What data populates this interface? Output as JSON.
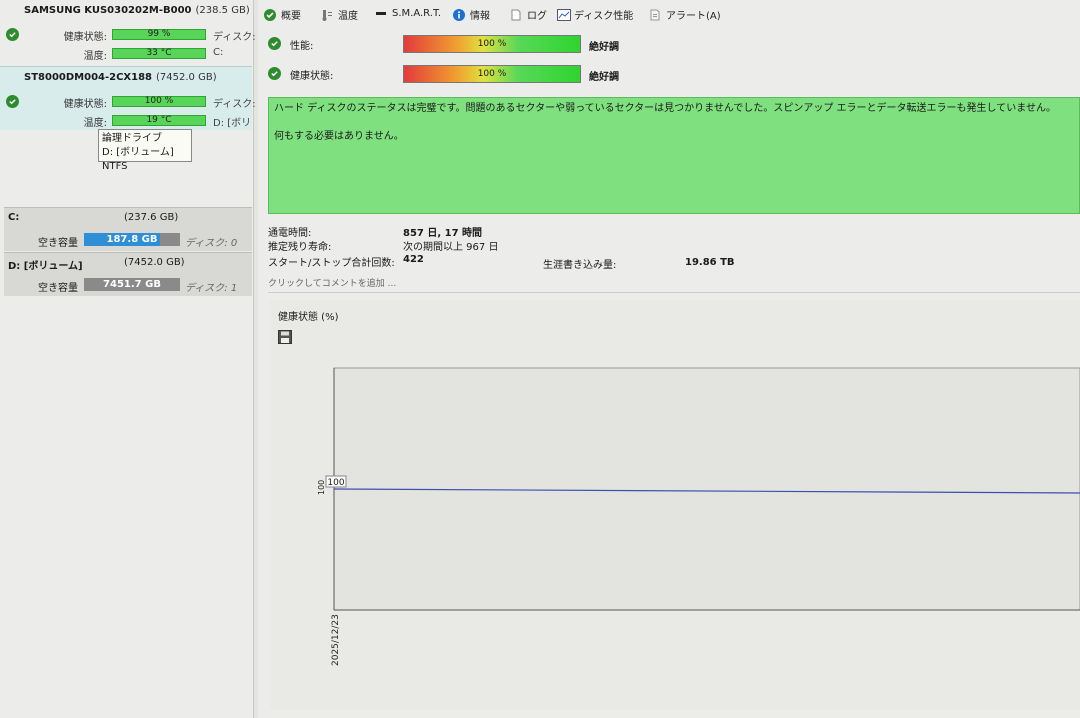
{
  "disks": [
    {
      "model": "SAMSUNG KUS030202M-B000",
      "size": "(238.5 GB)",
      "health_label": "健康状態:",
      "health_value": "99 %",
      "health_fraction": 0.99,
      "temp_label": "温度:",
      "temp_value": "33 °C",
      "side1": "ディスク:",
      "side2": "C:"
    },
    {
      "model": "ST8000DM004-2CX188",
      "size": "(7452.0 GB)",
      "health_label": "健康状態:",
      "health_value": "100 %",
      "health_fraction": 1.0,
      "temp_label": "温度:",
      "temp_value": "19 °C",
      "side1": "ディスク:",
      "side2": "D: [ボリ"
    }
  ],
  "tooltip": {
    "line1": "論理ドライブ",
    "line2": "D: [ボリューム] NTFS"
  },
  "volumes": [
    {
      "name": "C:",
      "capacity": "(237.6 GB)",
      "free_label": "空き容量",
      "free_value": "187.8 GB",
      "free_fraction": 0.79,
      "disk": "ディスク: 0"
    },
    {
      "name": "D: [ボリューム]",
      "capacity": "(7452.0 GB)",
      "free_label": "空き容量",
      "free_value": "7451.7 GB",
      "free_fraction": 0.0,
      "disk": "ディスク: 1"
    }
  ],
  "tabs": [
    {
      "label": "概要",
      "icon": "check-circle-icon"
    },
    {
      "label": "温度",
      "icon": "thermometer-icon"
    },
    {
      "label": "S.M.A.R.T.",
      "icon": "dash-icon"
    },
    {
      "label": "情報",
      "icon": "info-icon"
    },
    {
      "label": "ログ",
      "icon": "document-icon"
    },
    {
      "label": "ディスク性能",
      "icon": "chart-icon"
    },
    {
      "label": "アラート(A)",
      "icon": "alert-icon"
    }
  ],
  "meters": [
    {
      "label": "性能:",
      "value": "100 %",
      "fraction": 1.0,
      "rating": "絶好調"
    },
    {
      "label": "健康状態:",
      "value": "100 %",
      "fraction": 1.0,
      "rating": "絶好調"
    }
  ],
  "status": {
    "line1": "ハード ディスクのステータスは完璧です。問題のあるセクターや弱っているセクターは見つかりませんでした。スピンアップ エラーとデータ転送エラーも発生していません。",
    "line2": "何もする必要はありません。",
    "color": "#7fe07f"
  },
  "info": {
    "power_on_label": "通電時間:",
    "power_on_value": "857 日, 17 時間",
    "remaining_label": "推定残り寿命:",
    "remaining_value": "次の期間以上 967 日",
    "start_stop_label": "スタート/ストップ合計回数:",
    "start_stop_value": "422",
    "lifetime_writes_label": "生涯書き込み量:",
    "lifetime_writes_value": "19.86 TB",
    "comment_placeholder": "クリックしてコメントを追加 ..."
  },
  "chart_data": {
    "type": "line",
    "title": "健康状態 (%)",
    "x": [
      "2025/12/23"
    ],
    "series": [
      {
        "values": [
          100
        ]
      }
    ],
    "point_label": "100",
    "y_tick": "100",
    "grid": false
  }
}
